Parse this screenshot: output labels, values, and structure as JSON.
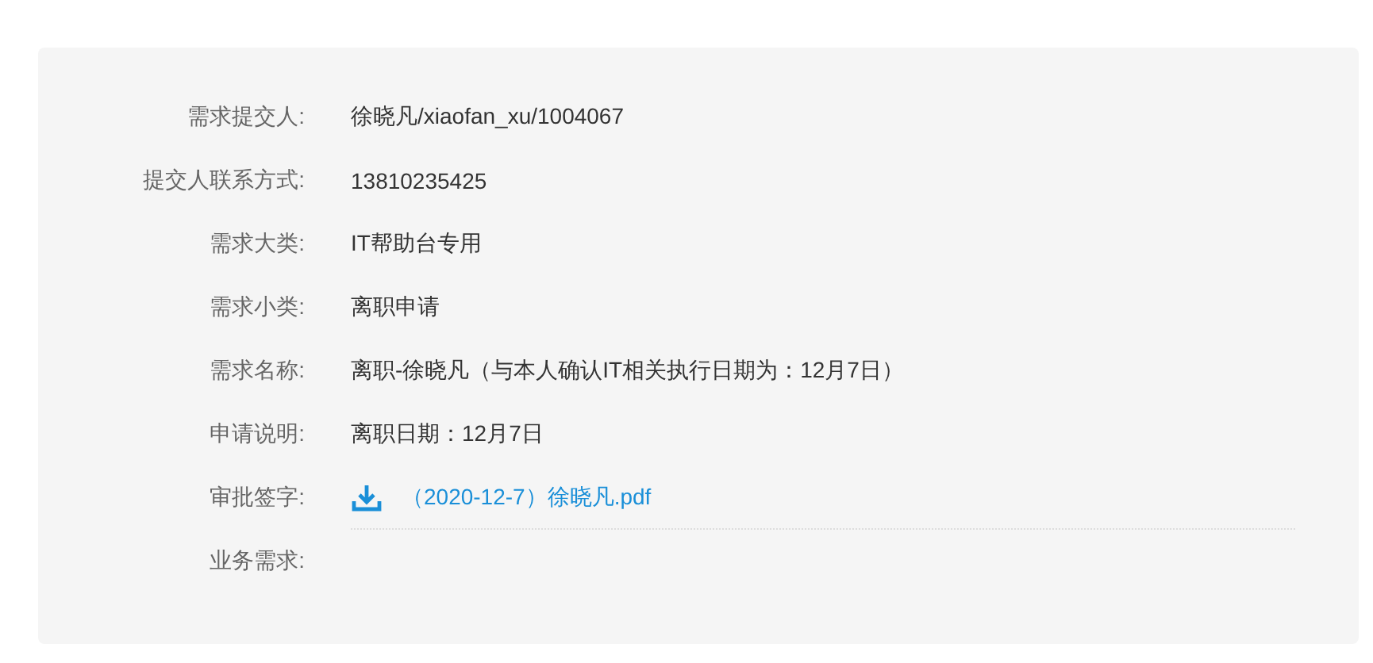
{
  "fields": [
    {
      "kind": "text",
      "label": "需求提交人:",
      "value": "徐晓凡/xiaofan_xu/1004067"
    },
    {
      "kind": "text",
      "label": "提交人联系方式:",
      "value": "13810235425"
    },
    {
      "kind": "text",
      "label": "需求大类:",
      "value": "IT帮助台专用"
    },
    {
      "kind": "text",
      "label": "需求小类:",
      "value": "离职申请"
    },
    {
      "kind": "text",
      "label": "需求名称:",
      "value": "离职-徐晓凡（与本人确认IT相关执行日期为：12月7日）"
    },
    {
      "kind": "text",
      "label": "申请说明:",
      "value": "离职日期：12月7日"
    },
    {
      "kind": "file",
      "label": "审批签字:",
      "value": "（2020-12-7）徐晓凡.pdf"
    },
    {
      "kind": "empty",
      "label": "业务需求:"
    }
  ]
}
